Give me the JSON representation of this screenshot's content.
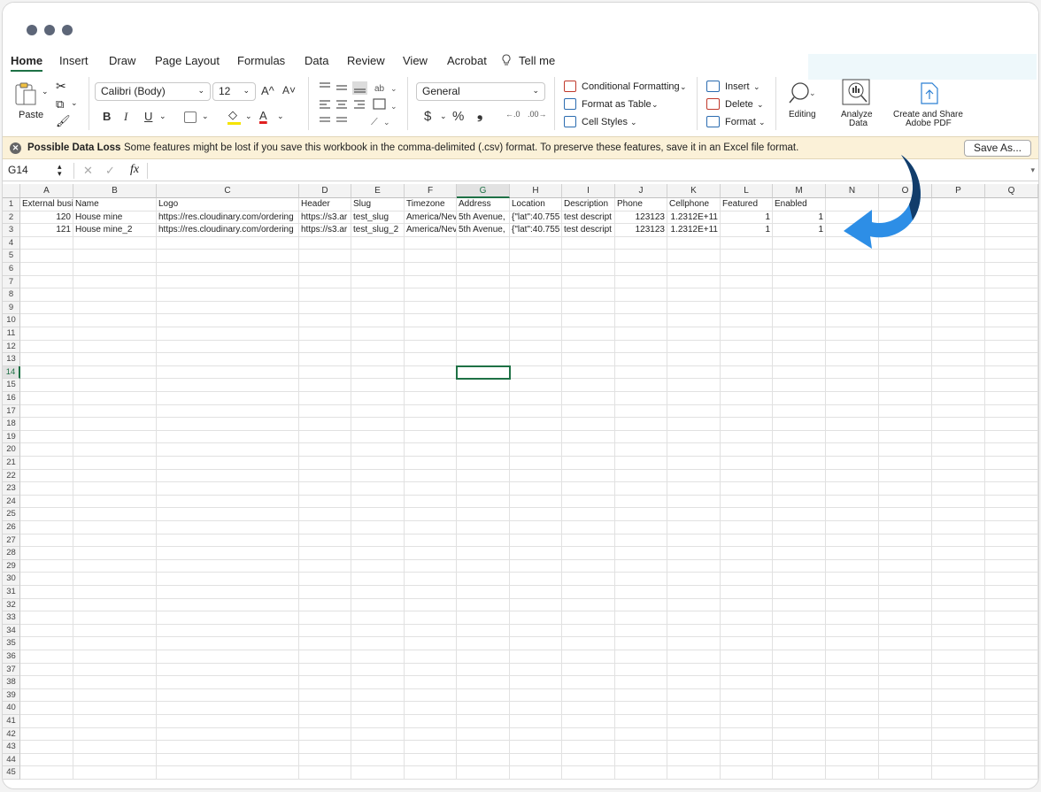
{
  "menu": {
    "items": [
      "Home",
      "Insert",
      "Draw",
      "Page Layout",
      "Formulas",
      "Data",
      "Review",
      "View",
      "Acrobat",
      "Tell me"
    ]
  },
  "ribbon": {
    "paste_label": "Paste",
    "font_name": "Calibri (Body)",
    "font_size": "12",
    "number_format": "General",
    "conditional_formatting": "Conditional Formatting",
    "format_as_table": "Format as Table",
    "cell_styles": "Cell Styles",
    "insert": "Insert",
    "delete": "Delete",
    "format": "Format",
    "editing": "Editing",
    "analyze_data_1": "Analyze",
    "analyze_data_2": "Data",
    "create_share_1": "Create and Share",
    "create_share_2": "Adobe PDF",
    "bold": "B",
    "italic": "I",
    "underline": "U",
    "currency": "$",
    "percent": "%",
    "comma": "❟",
    "grow_font": "A^",
    "shrink_font": "A˅",
    "font_color": "A"
  },
  "alert": {
    "title": "Possible Data Loss",
    "message": "Some features might be lost if you save this workbook in the comma-delimited (.csv) format. To preserve these features, save it in an Excel file format.",
    "button": "Save As..."
  },
  "formula_bar": {
    "name_box": "G14",
    "fx": "fx",
    "cancel": "✕",
    "enter": "✓"
  },
  "sheet": {
    "columns": [
      "A",
      "B",
      "C",
      "D",
      "E",
      "F",
      "G",
      "H",
      "I",
      "J",
      "K",
      "L",
      "M",
      "N",
      "O",
      "P",
      "Q"
    ],
    "header_row": [
      "External busi",
      "Name",
      "Logo",
      "Header",
      "Slug",
      "Timezone",
      "Address",
      "Location",
      "Description",
      "Phone",
      "Cellphone",
      "Featured",
      "Enabled"
    ],
    "rows": [
      [
        "120",
        "House mine",
        "https://res.cloudinary.com/ordering",
        "https://s3.ar",
        "test_slug",
        "America/Nev",
        "5th Avenue,",
        "{\"lat\":40.755",
        "test descript",
        "123123",
        "1.2312E+11",
        "1",
        "1"
      ],
      [
        "121",
        "House mine_2",
        "https://res.cloudinary.com/ordering",
        "https://s3.ar",
        "test_slug_2",
        "America/Nev",
        "5th Avenue,",
        "{\"lat\":40.755",
        "test descript",
        "123123",
        "1.2312E+11",
        "1",
        "1"
      ]
    ],
    "numeric_columns": [
      0,
      9,
      10,
      11,
      12
    ],
    "row_count": 45,
    "active_cell": "G14",
    "active_column": "G",
    "active_row": 14
  },
  "colors": {
    "accent": "#1e7145",
    "arrow": "#2d8ee6",
    "arrow_dark": "#123d6b",
    "alert_bg": "#fbf1d8"
  }
}
